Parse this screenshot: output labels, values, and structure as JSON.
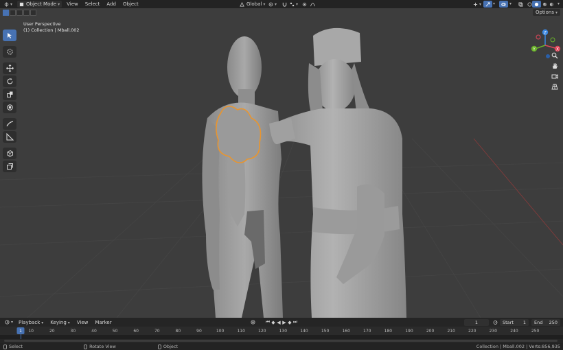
{
  "header": {
    "mode_label": "Object Mode",
    "menus": [
      "View",
      "Select",
      "Add",
      "Object"
    ],
    "orientation_label": "Global",
    "options_label": "Options",
    "accent": "#4772b3"
  },
  "viewport": {
    "view_name": "User Perspective",
    "collection_line": "(1) Collection | Mball.002",
    "selection_outline_color": "#e8952f",
    "background": "#3d3d3d"
  },
  "toolbar": {
    "tools": [
      "select-box-icon",
      "cursor-icon",
      "move-icon",
      "rotate-icon",
      "scale-icon",
      "transform-icon",
      "annotate-icon",
      "measure-icon",
      "add-cube-icon",
      "extrude-icon"
    ]
  },
  "gizmo": {
    "axes": {
      "z": "Z",
      "y": "Y",
      "x": "X"
    },
    "colors": {
      "x": "#e0465a",
      "y": "#6ab329",
      "z": "#3a86e0"
    }
  },
  "timeline": {
    "menus": [
      "Playback",
      "Keying",
      "View",
      "Marker"
    ],
    "current_frame": "1",
    "start_label": "Start",
    "start_value": "1",
    "end_label": "End",
    "end_value": "250",
    "ticks": [
      "1",
      "10",
      "20",
      "30",
      "40",
      "50",
      "60",
      "70",
      "80",
      "90",
      "100",
      "110",
      "120",
      "130",
      "140",
      "150",
      "160",
      "170",
      "180",
      "190",
      "200",
      "210",
      "220",
      "230",
      "240",
      "250"
    ],
    "playhead_label": "1"
  },
  "statusbar": {
    "select_label": "Select",
    "rotate_label": "Rotate View",
    "object_label": "Object",
    "stats": "Collection | Mball.002 | Verts:856,935"
  }
}
